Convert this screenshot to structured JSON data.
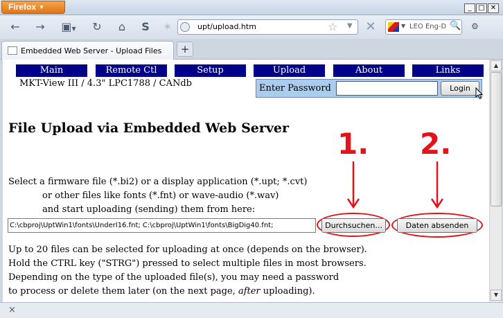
{
  "window": {
    "app_button": "Firefox",
    "minimize": "_",
    "maximize": "□",
    "close": "✕"
  },
  "navbar": {
    "url": "upt/upload.htm",
    "search_placeholder": "LEO Eng-D"
  },
  "tabs": [
    {
      "title": "Embedded Web Server - Upload Files"
    }
  ],
  "new_tab_label": "+",
  "page": {
    "menu": [
      "Main",
      "Remote Ctl",
      "Setup",
      "Upload",
      "About",
      "Links"
    ],
    "device_info": "MKT-View III / 4.3\" LPC1788 / CANdb",
    "login": {
      "label": "Enter Password",
      "button": "Login"
    },
    "heading": "File Upload via Embedded Web Server",
    "steps": [
      "1.",
      "2."
    ],
    "intro_lines": [
      "Select a firmware file (*.bi2) or a display application (*.upt; *.cvt)",
      "or other files like fonts (*.fnt) or wave-audio (*.wav)",
      "and start uploading (sending) them from here:"
    ],
    "file_path_value": "C:\\cbproj\\UptWin1\\fonts\\Underl16.fnt; C:\\cbproj\\UptWin1\\fonts\\BigDig40.fnt;",
    "browse_button": "Durchsuchen...",
    "submit_button": "Daten absenden",
    "info_lines": [
      "Up to 20 files can be selected for uploading at once (depends on the browser).",
      "Hold the CTRL key (\"STRG\") pressed to select multiple files in most browsers.",
      "Depending on the type of the uploaded file(s), you may need a password"
    ],
    "info_last": {
      "before": "to process or delete them later (on the next page, ",
      "em": "after",
      "after": " uploading)."
    }
  },
  "statusbar": {
    "close": "×"
  },
  "colors": {
    "menu_bg": "#00008b",
    "login_bg": "#aaccee",
    "annotation_red": "#e3121b",
    "firefox_orange": "#e2751a"
  },
  "icons": [
    "back-icon",
    "forward-icon",
    "bookmark-icon",
    "reload-icon",
    "home-icon",
    "sync-icon",
    "loading-icon",
    "globe-icon",
    "star-icon",
    "stop-icon",
    "leo-icon",
    "search-icon",
    "addon-icon",
    "favicon-icon",
    "cursor-icon"
  ]
}
